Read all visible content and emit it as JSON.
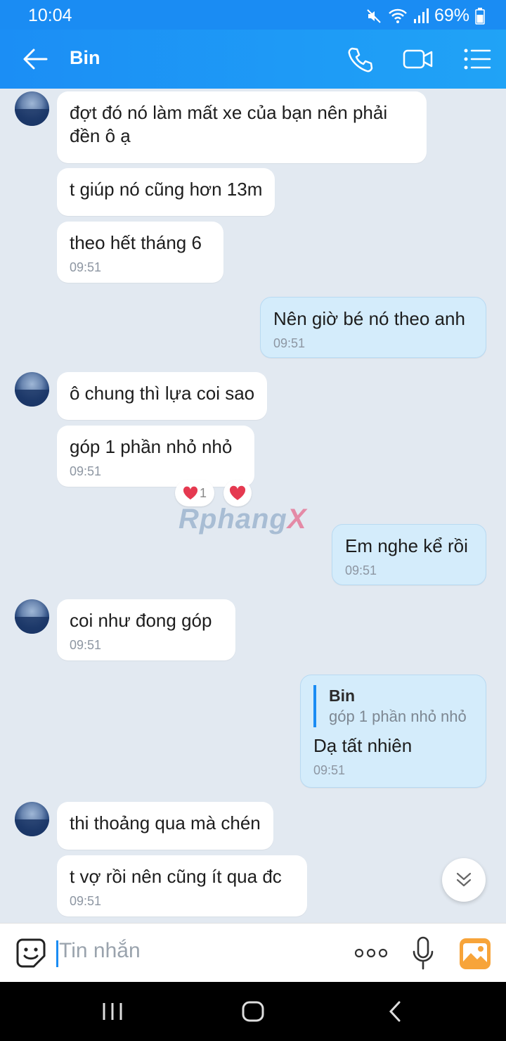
{
  "status_bar": {
    "time": "10:04",
    "battery": "69%"
  },
  "header": {
    "title": "Bin"
  },
  "messages": [
    {
      "text_line1": "đợt đó nó làm mất xe của bạn nên phải",
      "text_line2": "đền ô ạ"
    },
    {
      "text": "t giúp nó cũng hơn 13m"
    },
    {
      "text": "theo hết tháng 6",
      "time": "09:51"
    },
    {
      "text": "Nên giờ bé nó theo anh",
      "time": "09:51"
    },
    {
      "text": "ô chung thì lựa coi sao"
    },
    {
      "text": "góp 1 phần nhỏ nhỏ",
      "time": "09:51",
      "reaction_count": "1"
    },
    {
      "text": "Em nghe kể rồi",
      "time": "09:51"
    },
    {
      "text": "coi như đong góp",
      "time": "09:51"
    },
    {
      "quote_name": "Bin",
      "quote_text": "góp 1 phần nhỏ nhỏ",
      "text": "Dạ tất nhiên",
      "time": "09:51"
    },
    {
      "text": "thi thoảng qua mà chén"
    },
    {
      "text": "t vợ rồi nên cũng ít qua đc",
      "time": "09:51"
    }
  ],
  "watermark": {
    "main": "Rphang",
    "accent": "X"
  },
  "input": {
    "placeholder": "Tin nhắn"
  },
  "colors": {
    "accent": "#1a8cf3",
    "sent_bubble": "#d4ecfb",
    "background": "#e2e9f1",
    "heart": "#e53950"
  }
}
